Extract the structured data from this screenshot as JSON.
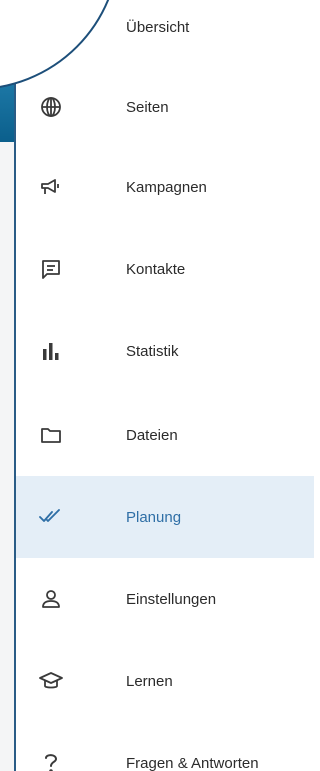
{
  "navigation": {
    "items": [
      {
        "id": "overview",
        "label": "Übersicht",
        "icon": "dashboard-icon",
        "active": false
      },
      {
        "id": "pages",
        "label": "Seiten",
        "icon": "globe-icon",
        "active": false
      },
      {
        "id": "campaigns",
        "label": "Kampagnen",
        "icon": "megaphone-icon",
        "active": false
      },
      {
        "id": "contacts",
        "label": "Kontakte",
        "icon": "message-icon",
        "active": false
      },
      {
        "id": "statistics",
        "label": "Statistik",
        "icon": "bar-chart-icon",
        "active": false
      },
      {
        "id": "files",
        "label": "Dateien",
        "icon": "folder-icon",
        "active": false
      },
      {
        "id": "planning",
        "label": "Planung",
        "icon": "double-check-icon",
        "active": true
      },
      {
        "id": "settings",
        "label": "Einstellungen",
        "icon": "user-icon",
        "active": false
      },
      {
        "id": "learning",
        "label": "Lernen",
        "icon": "graduation-cap-icon",
        "active": false
      },
      {
        "id": "faq",
        "label": "Fragen & Antworten",
        "icon": "question-icon",
        "active": false
      }
    ]
  },
  "colors": {
    "active_background": "#e4eef7",
    "active_text": "#2f6fa6",
    "text": "#2b2b2b",
    "icon": "#3a3a3a",
    "accent": "#1d4f7a"
  }
}
